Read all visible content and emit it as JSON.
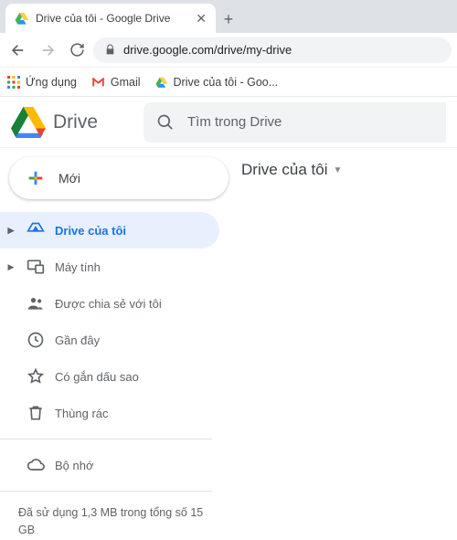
{
  "browser": {
    "tab_title": "Drive của tôi - Google Drive",
    "url": "drive.google.com/drive/my-drive",
    "bookmarks": {
      "apps": "Ứng dụng",
      "gmail": "Gmail",
      "drive": "Drive của tôi - Goo..."
    }
  },
  "header": {
    "product": "Drive",
    "search_placeholder": "Tìm trong Drive"
  },
  "sidebar": {
    "new_label": "Mới",
    "items": [
      {
        "label": "Drive của tôi"
      },
      {
        "label": "Máy tính"
      },
      {
        "label": "Được chia sẻ với tôi"
      },
      {
        "label": "Gần đây"
      },
      {
        "label": "Có gắn dấu sao"
      },
      {
        "label": "Thùng rác"
      }
    ],
    "storage_label": "Bộ nhớ",
    "storage_text": "Đã sử dụng 1,3 MB trong tổng số 15 GB"
  },
  "main": {
    "location": "Drive của tôi"
  }
}
